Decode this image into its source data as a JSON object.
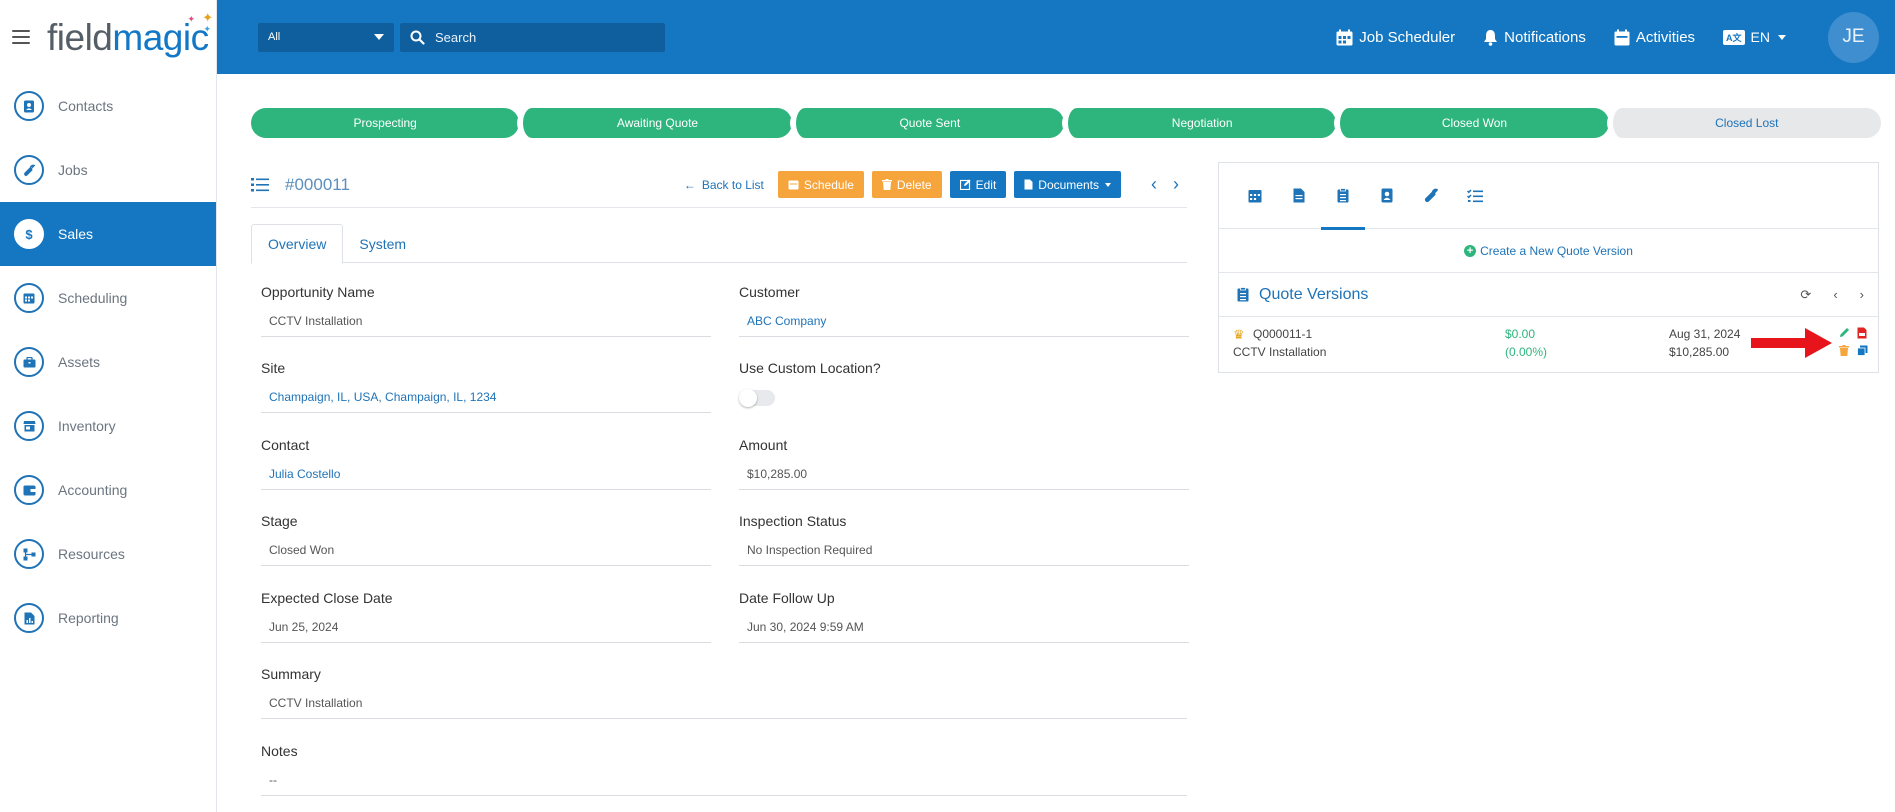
{
  "app": {
    "brand_part1": "field",
    "brand_part2": "magic"
  },
  "sidebar": {
    "items": [
      {
        "label": "Contacts",
        "icon": "contact-icon"
      },
      {
        "label": "Jobs",
        "icon": "wrench-icon"
      },
      {
        "label": "Sales",
        "icon": "dollar-icon",
        "active": true
      },
      {
        "label": "Scheduling",
        "icon": "calendar-icon"
      },
      {
        "label": "Assets",
        "icon": "briefcase-icon"
      },
      {
        "label": "Inventory",
        "icon": "store-icon"
      },
      {
        "label": "Accounting",
        "icon": "wallet-icon"
      },
      {
        "label": "Resources",
        "icon": "network-icon"
      },
      {
        "label": "Reporting",
        "icon": "report-icon"
      }
    ]
  },
  "topbar": {
    "filter_value": "All",
    "search_placeholder": "Search",
    "job_scheduler": "Job Scheduler",
    "notifications": "Notifications",
    "activities": "Activities",
    "language": "EN",
    "avatar_initials": "JE"
  },
  "stages": [
    "Prospecting",
    "Awaiting Quote",
    "Quote Sent",
    "Negotiation",
    "Closed Won",
    "Closed Lost"
  ],
  "record": {
    "id": "#000011",
    "back_label": "Back to List",
    "schedule_label": "Schedule",
    "delete_label": "Delete",
    "edit_label": "Edit",
    "documents_label": "Documents"
  },
  "tabs": [
    "Overview",
    "System"
  ],
  "fields": {
    "opportunity_name": {
      "label": "Opportunity Name",
      "value": "CCTV Installation"
    },
    "customer": {
      "label": "Customer",
      "value": "ABC Company"
    },
    "site": {
      "label": "Site",
      "value": "Champaign, IL, USA, Champaign, IL, 1234"
    },
    "custom_location": {
      "label": "Use Custom Location?"
    },
    "contact": {
      "label": "Contact",
      "value": "Julia Costello"
    },
    "amount": {
      "label": "Amount",
      "value": "$10,285.00"
    },
    "stage": {
      "label": "Stage",
      "value": "Closed Won"
    },
    "inspection": {
      "label": "Inspection Status",
      "value": "No Inspection Required"
    },
    "close_date": {
      "label": "Expected Close Date",
      "value": "Jun 25, 2024"
    },
    "follow_up": {
      "label": "Date Follow Up",
      "value": "Jun 30, 2024 9:59 AM"
    },
    "summary": {
      "label": "Summary",
      "value": "CCTV Installation"
    },
    "notes": {
      "label": "Notes",
      "value": "--"
    }
  },
  "panel": {
    "create_label": "Create a New Quote Version",
    "title": "Quote Versions",
    "quote": {
      "number": "Q000011-1",
      "name": "CCTV Installation",
      "amount": "$0.00",
      "percent": "(0.00%)",
      "date": "Aug 31, 2024",
      "total": "$10,285.00"
    }
  },
  "colors": {
    "brand_blue": "#1577c1",
    "stage_green": "#2eb57d",
    "button_orange": "#f5a53c",
    "arrow_red": "#e8141c"
  }
}
